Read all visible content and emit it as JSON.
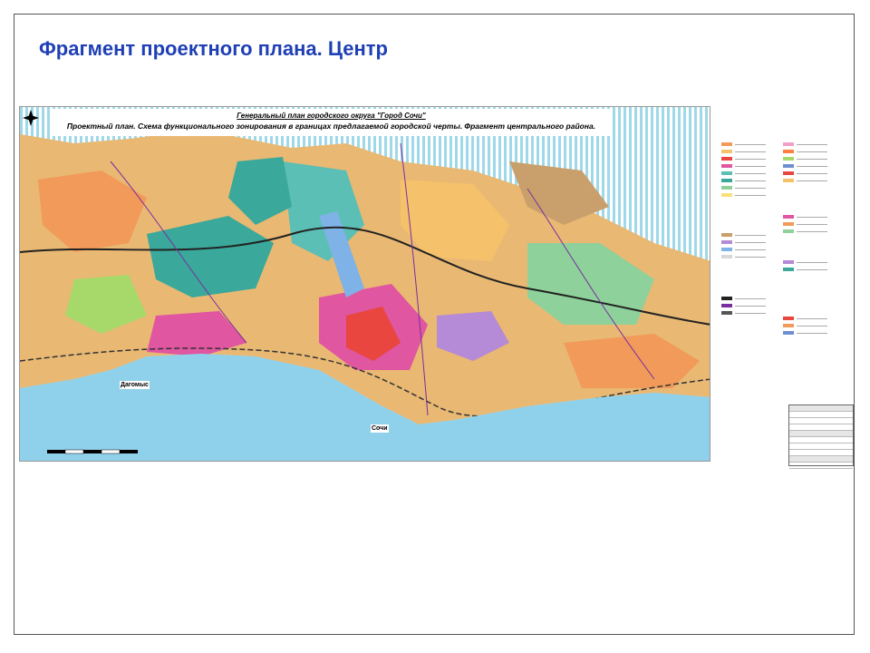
{
  "slide": {
    "title": "Фрагмент проектного плана. Центр"
  },
  "map": {
    "header_line1": "Генеральный план городского округа \"Город Сочи\"",
    "header_line2": "Проектный план. Схема функционального зонирования в границах предлагаемой городской черты. Фрагмент центрального района.",
    "place_labels": [
      "Дагомыс",
      "Сочи"
    ],
    "sea_color": "#8fd0ea",
    "stripe_color": "#9fd8e8"
  },
  "legend": {
    "zone_colors": [
      "#f19a5a",
      "#f5c26b",
      "#e8463e",
      "#e056a0",
      "#5bbfb5",
      "#3aa89a",
      "#8fd19b",
      "#f7e27a",
      "#c9a06b",
      "#b58ad6",
      "#7fb2e6",
      "#d8d8d8",
      "#f0a0c8",
      "#a6d96a",
      "#ff7f3f",
      "#6e8fd0"
    ]
  }
}
